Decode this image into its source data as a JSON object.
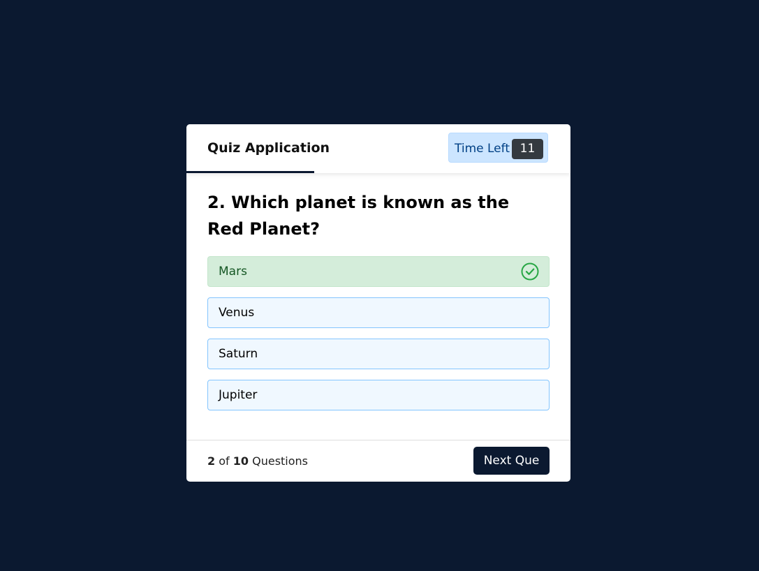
{
  "header": {
    "title": "Quiz Application",
    "timer_label": "Time Left",
    "timer_seconds": "11"
  },
  "question": {
    "text": "2. Which planet is known as the Red Planet?"
  },
  "options": [
    {
      "label": "Mars",
      "state": "correct",
      "icon": "check-circle-icon"
    },
    {
      "label": "Venus",
      "state": "default"
    },
    {
      "label": "Saturn",
      "state": "default"
    },
    {
      "label": "Jupiter",
      "state": "default"
    }
  ],
  "footer": {
    "current": "2",
    "of_text": "of",
    "total": "10",
    "questions_text": "Questions",
    "next_label": "Next Que"
  },
  "colors": {
    "background": "#0b1930",
    "correct_bg": "#d4edda",
    "correct_text": "#155724",
    "check_icon": "#28a745",
    "option_bg": "#f0f8ff",
    "option_border": "#84c5fe",
    "timer_bg": "#cce5ff"
  }
}
